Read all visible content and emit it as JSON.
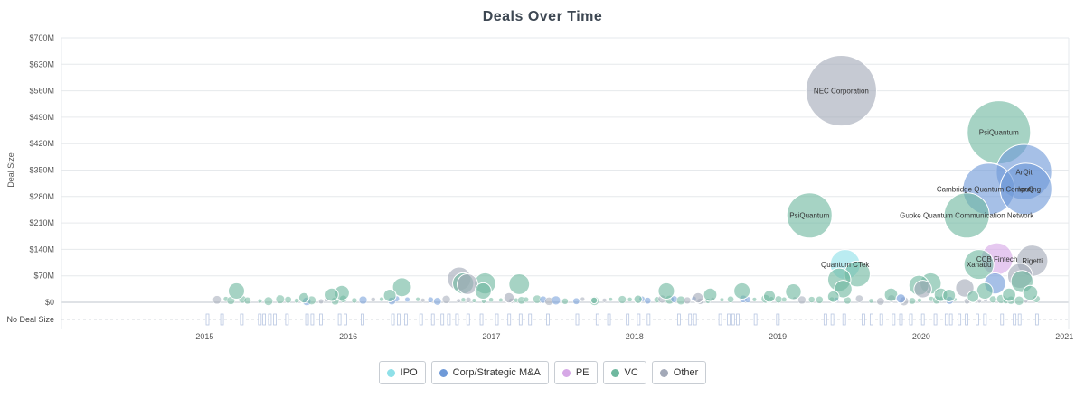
{
  "chart_data": {
    "type": "scatter",
    "title": "Deals Over Time",
    "xlabel": "",
    "ylabel": "Deal Size",
    "xlim": [
      "2014-07-01",
      "2021-07-12"
    ],
    "ylim": [
      0,
      700
    ],
    "y_unit": "$M",
    "y_ticks": [
      "$0",
      "$70M",
      "$140M",
      "$210M",
      "$280M",
      "$350M",
      "$420M",
      "$490M",
      "$560M",
      "$630M",
      "$700M"
    ],
    "x_ticks": [
      "2015",
      "2016",
      "2017",
      "2018",
      "2019",
      "2020",
      "2021"
    ],
    "no_deal_size_label": "No Deal Size",
    "grid": true,
    "legend_position": "bottom",
    "legend": [
      "IPO",
      "Corp/Strategic M&A",
      "PE",
      "VC",
      "Other"
    ],
    "colors": {
      "IPO": "#8fe0e8",
      "Corp/Strategic M&A": "#6f9ad8",
      "PE": "#d6a8e6",
      "VC": "#6fb89f",
      "Other": "#a3a9b8"
    },
    "labeled_deals": [
      {
        "label": "NEC Corporation",
        "date": "2019-12-10",
        "value": 560,
        "type": "Other"
      },
      {
        "label": "PsiQuantum",
        "date": "2021-01-15",
        "value": 450,
        "type": "VC"
      },
      {
        "label": "ArQit",
        "date": "2021-03-20",
        "value": 345,
        "type": "Corp/Strategic M&A"
      },
      {
        "label": "Cambridge Quantum Computing",
        "date": "2020-12-20",
        "value": 300,
        "type": "Corp/Strategic M&A"
      },
      {
        "label": "IonQ",
        "date": "2021-03-25",
        "value": 300,
        "type": "Corp/Strategic M&A"
      },
      {
        "label": "PsiQuantum",
        "date": "2019-09-20",
        "value": 230,
        "type": "VC"
      },
      {
        "label": "Guoke Quantum Communication Network",
        "date": "2020-10-25",
        "value": 230,
        "type": "VC"
      },
      {
        "label": "CCB Fintech",
        "date": "2021-01-10",
        "value": 115,
        "type": "PE"
      },
      {
        "label": "Xanadu",
        "date": "2020-11-25",
        "value": 100,
        "type": "VC"
      },
      {
        "label": "Rigetti",
        "date": "2021-04-10",
        "value": 110,
        "type": "Other"
      },
      {
        "label": "Quantum CTek",
        "date": "2019-12-20",
        "value": 100,
        "type": "IPO"
      }
    ],
    "other_deals": [
      {
        "date": "2015-09-20",
        "value": 30,
        "type": "VC"
      },
      {
        "date": "2016-03-10",
        "value": 12,
        "type": "VC"
      },
      {
        "date": "2016-05-20",
        "value": 20,
        "type": "VC"
      },
      {
        "date": "2016-06-15",
        "value": 25,
        "type": "VC"
      },
      {
        "date": "2016-10-15",
        "value": 18,
        "type": "VC"
      },
      {
        "date": "2016-11-15",
        "value": 40,
        "type": "VC"
      },
      {
        "date": "2017-04-10",
        "value": 62,
        "type": "Other"
      },
      {
        "date": "2017-04-20",
        "value": 50,
        "type": "VC"
      },
      {
        "date": "2017-05-01",
        "value": 48,
        "type": "Other"
      },
      {
        "date": "2017-06-15",
        "value": 50,
        "type": "VC"
      },
      {
        "date": "2017-06-10",
        "value": 30,
        "type": "VC"
      },
      {
        "date": "2017-09-10",
        "value": 48,
        "type": "VC"
      },
      {
        "date": "2017-08-15",
        "value": 12,
        "type": "Other"
      },
      {
        "date": "2018-03-20",
        "value": 5,
        "type": "VC"
      },
      {
        "date": "2018-07-10",
        "value": 8,
        "type": "VC"
      },
      {
        "date": "2018-09-20",
        "value": 30,
        "type": "VC"
      },
      {
        "date": "2018-12-10",
        "value": 12,
        "type": "Other"
      },
      {
        "date": "2019-01-10",
        "value": 20,
        "type": "VC"
      },
      {
        "date": "2019-04-01",
        "value": 30,
        "type": "VC"
      },
      {
        "date": "2019-06-10",
        "value": 16,
        "type": "VC"
      },
      {
        "date": "2019-08-10",
        "value": 28,
        "type": "VC"
      },
      {
        "date": "2019-11-20",
        "value": 15,
        "type": "VC"
      },
      {
        "date": "2019-12-05",
        "value": 60,
        "type": "VC"
      },
      {
        "date": "2019-12-15",
        "value": 35,
        "type": "VC"
      },
      {
        "date": "2020-01-20",
        "value": 75,
        "type": "VC"
      },
      {
        "date": "2020-04-15",
        "value": 20,
        "type": "VC"
      },
      {
        "date": "2020-05-10",
        "value": 10,
        "type": "Corp/Strategic M&A"
      },
      {
        "date": "2020-06-25",
        "value": 45,
        "type": "VC"
      },
      {
        "date": "2020-07-05",
        "value": 35,
        "type": "Other"
      },
      {
        "date": "2020-07-25",
        "value": 50,
        "type": "VC"
      },
      {
        "date": "2020-08-20",
        "value": 20,
        "type": "VC"
      },
      {
        "date": "2020-09-10",
        "value": 18,
        "type": "VC"
      },
      {
        "date": "2020-10-20",
        "value": 38,
        "type": "Other"
      },
      {
        "date": "2020-11-10",
        "value": 15,
        "type": "VC"
      },
      {
        "date": "2020-12-10",
        "value": 30,
        "type": "VC"
      },
      {
        "date": "2021-01-05",
        "value": 50,
        "type": "Corp/Strategic M&A"
      },
      {
        "date": "2021-02-10",
        "value": 20,
        "type": "VC"
      },
      {
        "date": "2021-03-10",
        "value": 70,
        "type": "Other"
      },
      {
        "date": "2021-03-15",
        "value": 55,
        "type": "VC"
      },
      {
        "date": "2021-04-05",
        "value": 25,
        "type": "VC"
      }
    ]
  }
}
